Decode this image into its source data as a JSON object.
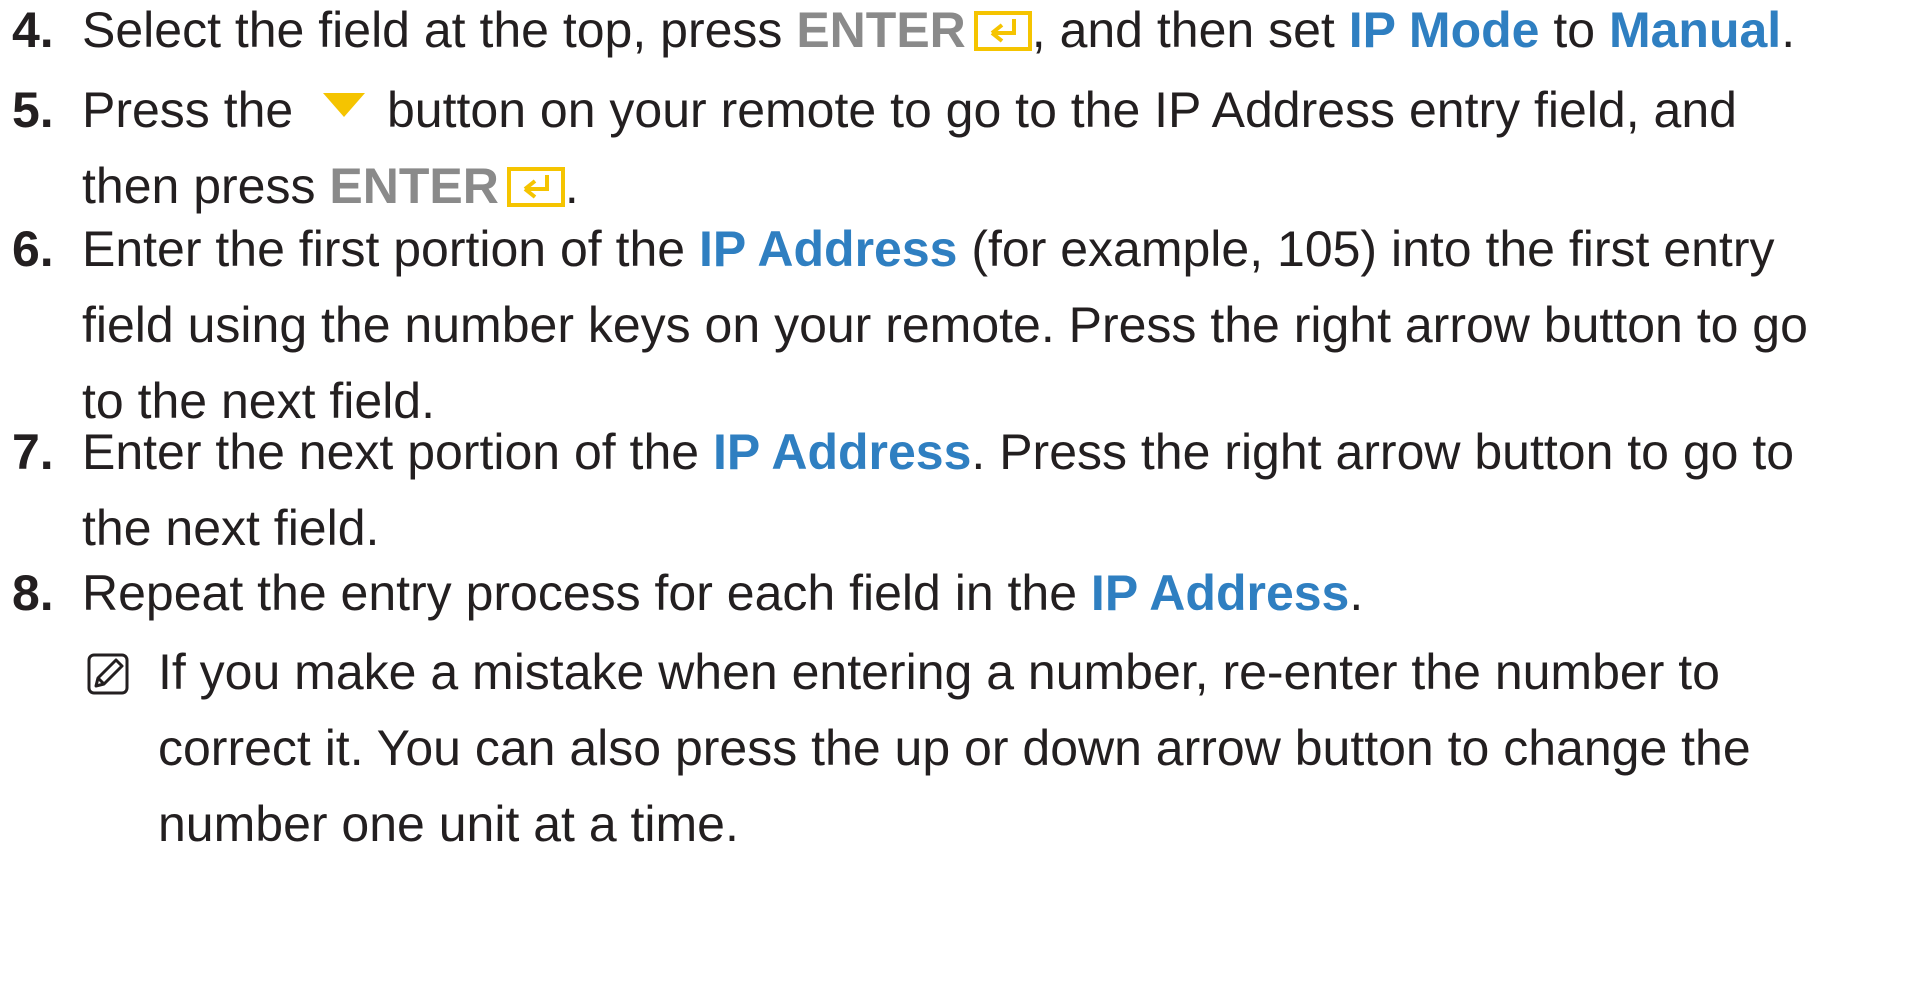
{
  "steps": [
    {
      "number": "4.",
      "lines": [
        [
          "Select the field at the top, press ",
          "ENTER",
          ", and then set ",
          "IP Mode",
          " to ",
          "Manual",
          "."
        ]
      ]
    },
    {
      "number": "5.",
      "lines": [
        [
          "Press the ",
          " button on your remote to go to the IP Address entry field, and"
        ],
        [
          "then press ",
          "ENTER",
          "."
        ]
      ]
    },
    {
      "number": "6.",
      "lines": [
        [
          "Enter the first portion of the ",
          "IP Address",
          " (for example, 105) into the first entry"
        ],
        [
          "field using the number keys on your remote. Press the right arrow button to go"
        ],
        [
          "to the next field."
        ]
      ]
    },
    {
      "number": "7.",
      "lines": [
        [
          "Enter the next portion of the ",
          "IP Address",
          ". Press the right arrow button to go to"
        ],
        [
          "the next field."
        ]
      ]
    },
    {
      "number": "8.",
      "lines": [
        [
          "Repeat the entry process for each field in the ",
          "IP Address",
          "."
        ]
      ]
    }
  ],
  "note": {
    "icon": "note-icon",
    "lines": [
      "If you make a mistake when entering a number, re-enter the number to",
      "correct it. You can also press the up or down arrow button to change the",
      "number one unit at a time."
    ]
  },
  "colors": {
    "text": "#231f20",
    "highlight": "#2f7fc1",
    "button_label": "#8a8a8a",
    "icon_yellow": "#f5c400"
  }
}
